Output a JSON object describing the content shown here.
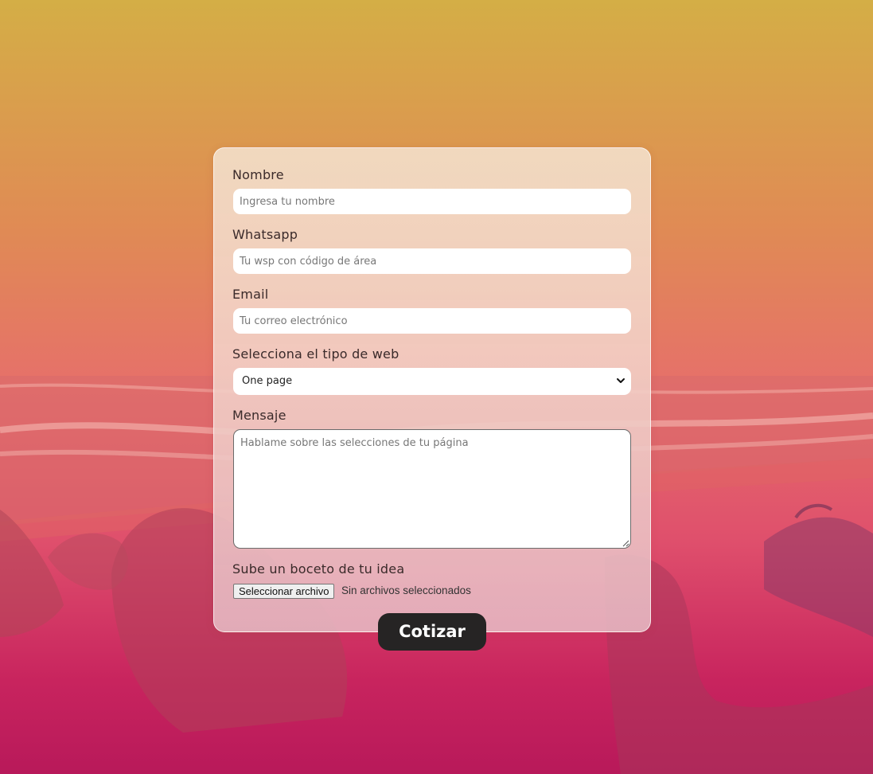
{
  "form": {
    "nombre": {
      "label": "Nombre",
      "placeholder": "Ingresa tu nombre"
    },
    "whatsapp": {
      "label": "Whatsapp",
      "placeholder": "Tu wsp con código de área"
    },
    "email": {
      "label": "Email",
      "placeholder": "Tu correo electrónico"
    },
    "tipo_web": {
      "label": "Selecciona el tipo de web",
      "selected": "One page"
    },
    "mensaje": {
      "label": "Mensaje",
      "placeholder": "Hablame sobre las selecciones de tu página"
    },
    "boceto": {
      "label": "Sube un boceto de tu idea",
      "button_label": "Seleccionar archivo",
      "status": "Sin archivos seleccionados"
    },
    "submit_label": "Cotizar"
  },
  "colors": {
    "button_bg": "#262424",
    "background_top": "#d4ae46",
    "background_bottom": "#b8195a"
  }
}
